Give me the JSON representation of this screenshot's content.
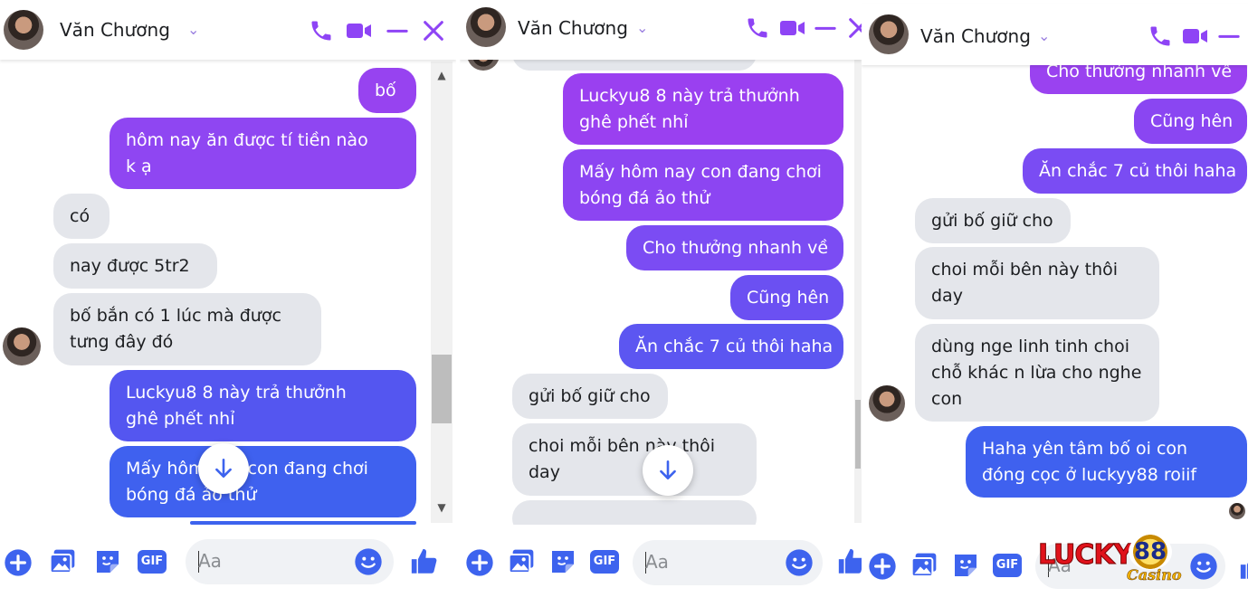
{
  "contact_name": "Văn Chương",
  "composer_placeholder": "Aa",
  "composer_icons": [
    "plus-icon",
    "image-icon",
    "sticker-icon",
    "gif-icon",
    "emoji-icon",
    "like-icon"
  ],
  "gif_label": "GIF",
  "colors": {
    "accent": "#8e44f5",
    "blue": "#3d63ee",
    "incoming": "#e4e6eb"
  },
  "panel1": {
    "messages": [
      {
        "dir": "out",
        "lines": [
          "bố"
        ]
      },
      {
        "dir": "out",
        "lines": [
          "hôm nay ăn được tí tiền nào",
          "k ạ"
        ]
      },
      {
        "dir": "in",
        "lines": [
          "có"
        ]
      },
      {
        "dir": "in",
        "lines": [
          "nay được 5tr2"
        ]
      },
      {
        "dir": "in",
        "lines": [
          "bố bắn có 1 lúc mà được",
          "tưng đây đó"
        ]
      },
      {
        "dir": "out",
        "lines": [
          "Luckyu8 8 này trả thưởnh",
          "ghê phết nhỉ"
        ]
      },
      {
        "dir": "out",
        "lines": [
          "Mấy hôm nay con đang chơi",
          "bóng đá ảo thử"
        ]
      }
    ]
  },
  "panel2": {
    "messages": [
      {
        "dir": "out",
        "lines": [
          "Luckyu8 8 này trả thưởnh",
          "ghê phết nhỉ"
        ]
      },
      {
        "dir": "out",
        "lines": [
          "Mấy hôm nay con đang chơi",
          "bóng đá ảo thử"
        ]
      },
      {
        "dir": "out",
        "lines": [
          "Cho thưởng nhanh về"
        ]
      },
      {
        "dir": "out",
        "lines": [
          "Cũng hên"
        ]
      },
      {
        "dir": "out",
        "lines": [
          "Ăn chắc 7 củ thôi haha"
        ]
      },
      {
        "dir": "in",
        "lines": [
          "gửi bố giữ cho"
        ]
      },
      {
        "dir": "in",
        "lines": [
          "choi mỗi bên này thôi",
          "day"
        ]
      }
    ]
  },
  "panel3": {
    "messages": [
      {
        "dir": "out",
        "lines": [
          "Cho thưởng nhanh về"
        ]
      },
      {
        "dir": "out",
        "lines": [
          "Cũng hên"
        ]
      },
      {
        "dir": "out",
        "lines": [
          "Ăn chắc 7 củ thôi haha"
        ]
      },
      {
        "dir": "in",
        "lines": [
          "gửi bố giữ cho"
        ]
      },
      {
        "dir": "in",
        "lines": [
          "choi mỗi bên này thôi",
          "day"
        ]
      },
      {
        "dir": "in",
        "lines": [
          "dùng nge linh tinh choi",
          "chỗ khác n lừa cho nghe",
          "con"
        ]
      },
      {
        "dir": "out",
        "lines": [
          "Haha yên tâm bố oi con",
          "đóng cọc ở luckyy88 roiif"
        ]
      }
    ]
  },
  "watermark": {
    "brand": "LUCKY",
    "number": "88",
    "tagline": "Casino"
  }
}
